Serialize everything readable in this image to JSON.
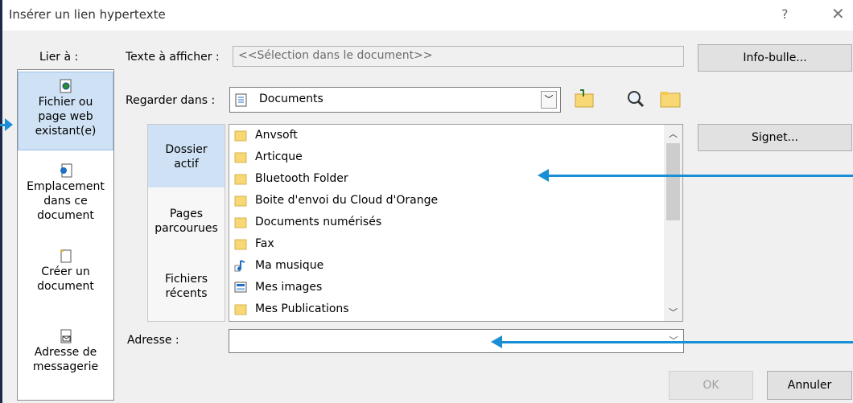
{
  "dialog": {
    "title": "Insérer un lien hypertexte",
    "help": "?",
    "close": "✕"
  },
  "link_to": {
    "label": "Lier à :",
    "items": [
      {
        "line1": "Fichier ou",
        "line2": "page web",
        "line3": "existant(e)"
      },
      {
        "line1": "Emplacement",
        "line2": "dans ce",
        "line3": "document"
      },
      {
        "line1": "Créer un",
        "line2": "document"
      },
      {
        "line1": "Adresse de",
        "line2": "messagerie"
      }
    ]
  },
  "display_text": {
    "label": "Texte à afficher :",
    "value": "<<Sélection dans le document>>"
  },
  "tooltip_button": "Info-bulle...",
  "look_in": {
    "label": "Regarder dans :",
    "value": "Documents"
  },
  "bookmark_button": "Signet...",
  "tabs": [
    {
      "line1": "Dossier",
      "line2": "actif"
    },
    {
      "line1": "Pages",
      "line2": "parcourues"
    },
    {
      "line1": "Fichiers",
      "line2": "récents"
    }
  ],
  "files": [
    {
      "name": "Anvsoft",
      "icon": "folder-icon"
    },
    {
      "name": "Articque",
      "icon": "folder-icon"
    },
    {
      "name": "Bluetooth Folder",
      "icon": "folder-icon"
    },
    {
      "name": "Boite d'envoi du Cloud d'Orange",
      "icon": "folder-icon"
    },
    {
      "name": "Documents numérisés",
      "icon": "folder-icon"
    },
    {
      "name": "Fax",
      "icon": "folder-icon"
    },
    {
      "name": "Ma musique",
      "icon": "music-folder-icon"
    },
    {
      "name": "Mes images",
      "icon": "pictures-folder-icon"
    },
    {
      "name": "Mes Publications",
      "icon": "folder-icon"
    }
  ],
  "address": {
    "label": "Adresse :",
    "value": ""
  },
  "ok_button": "OK",
  "cancel_button": "Annuler",
  "colors": {
    "accent_arrow": "#1a8fd6",
    "selected_bg": "#cfe2f5",
    "folder": "#f8d775"
  }
}
